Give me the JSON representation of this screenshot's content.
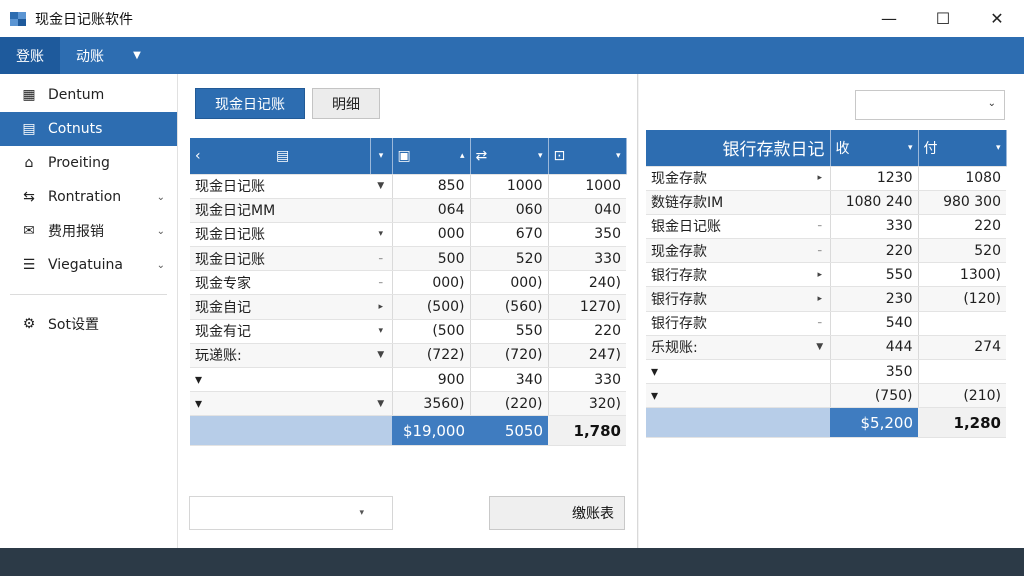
{
  "window": {
    "title": "现金日记账软件",
    "controls": {
      "minimize": "—",
      "maximize": "☐",
      "close": "✕"
    }
  },
  "menubar": {
    "items": [
      {
        "label": "登账"
      },
      {
        "label": "动账"
      }
    ]
  },
  "sidebar": {
    "items": [
      {
        "label": "Dentum",
        "icon": "building-icon"
      },
      {
        "label": "Cotnuts",
        "icon": "stack-icon"
      },
      {
        "label": "Proeiting",
        "icon": "bank-icon"
      },
      {
        "label": "Rontration",
        "icon": "transfer-icon"
      },
      {
        "label": "费用报销",
        "icon": "mail-icon"
      },
      {
        "label": "Viegatuina",
        "icon": "list-icon"
      }
    ],
    "settings_label": "Sot设置"
  },
  "left_panel": {
    "primary_button": "现金日记账",
    "secondary_button": "明细",
    "table": {
      "header_symbols": [
        "‹",
        "▤",
        "▾",
        "▣",
        "▴",
        "⇄",
        "▾",
        "⊡",
        "▾"
      ],
      "rows": [
        {
          "label": "现金日记账",
          "dd": "▼",
          "c1": "850",
          "c2": "1000",
          "c3": "1000"
        },
        {
          "label": "现金日记MM",
          "dd": "",
          "c1": "064",
          "c2": "060",
          "c3": "040"
        },
        {
          "label": "现金日记账",
          "dd": "▾",
          "c1": "000",
          "c2": "670",
          "c3": "350"
        },
        {
          "label": "现金日记账",
          "dd": "–",
          "c1": "500",
          "c2": "520",
          "c3": "330"
        },
        {
          "label": "现金专家",
          "dd": "–",
          "c1": "000)",
          "c2": "000)",
          "c3": "240)"
        },
        {
          "label": "现金自记",
          "dd": "▸",
          "c1": "(500)",
          "c2": "(560)",
          "c3": "1270)"
        },
        {
          "label": "现金有记",
          "dd": "▾",
          "c1": "(500",
          "c2": "550",
          "c3": "220"
        },
        {
          "label": "玩递账:",
          "dd": "▼",
          "c1": "(722)",
          "c2": "(720)",
          "c3": "247)"
        },
        {
          "label": "▾",
          "dd": "",
          "c1": "900",
          "c2": "340",
          "c3": "330"
        },
        {
          "label": "▾",
          "dd": "▼",
          "c1": "3560)",
          "c2": "(220)",
          "c3": "320)"
        }
      ],
      "totals": {
        "c1": "$19,000",
        "c2": "5050",
        "c3": "1,780"
      }
    },
    "bottom_select_arrow": "▾",
    "bottom_button": "缴账表"
  },
  "right_panel": {
    "table": {
      "header_title": "银行存款日记",
      "header_col1": "收",
      "header_col2": "付",
      "rows": [
        {
          "label": "现金存款",
          "dd": "▸",
          "c1": "1230",
          "c2": "1080"
        },
        {
          "label": "数链存款IM",
          "dd": "",
          "c1": "1080 240",
          "c2": "980 300"
        },
        {
          "label": "银金日记账",
          "dd": "–",
          "c1": "330",
          "c2": "220"
        },
        {
          "label": "现金存款",
          "dd": "–",
          "c1": "220",
          "c2": "520"
        },
        {
          "label": "银行存款",
          "dd": "▸",
          "c1": "550",
          "c2": "1300)"
        },
        {
          "label": "银行存款",
          "dd": "▸",
          "c1": "230",
          "c2": "(120)"
        },
        {
          "label": "银行存款",
          "dd": "–",
          "c1": "540",
          "c2": ""
        },
        {
          "label": "乐规账:",
          "dd": "▼",
          "c1": "444",
          "c2": "274"
        },
        {
          "label": "▾",
          "dd": "",
          "c1": "350",
          "c2": ""
        },
        {
          "label": "▾",
          "dd": "",
          "c1": "(750)",
          "c2": "(210)"
        }
      ],
      "totals": {
        "c1": "$5,200",
        "c2": "1,280"
      }
    }
  },
  "colors": {
    "accent": "#2d6db1",
    "total_row": "#b7cde8",
    "statusbar": "#2c3a47"
  }
}
